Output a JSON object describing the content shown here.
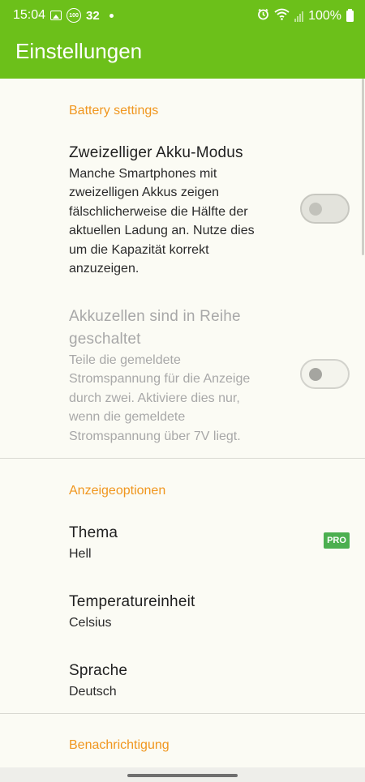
{
  "status_bar": {
    "time": "15:04",
    "badge_icon_text": "100",
    "notification_count": "32",
    "battery": "100%"
  },
  "app_bar": {
    "title": "Einstellungen",
    "background": "#6cc01a"
  },
  "sections": {
    "battery": {
      "header": "Battery settings",
      "dual_cell": {
        "title": "Zweizelliger Akku-Modus",
        "summary": "Manche Smartphones mit zweizelligen Akkus zeigen fälschlicherweise die Hälfte der aktuellen Ladung an. Nutze dies um die Kapazität korrekt anzuzeigen.",
        "checked": false,
        "enabled": true
      },
      "series_cells": {
        "title": "Akkuzellen sind in Reihe geschaltet",
        "summary": "Teile die gemeldete Stromspannung für die Anzeige durch zwei. Aktiviere dies nur, wenn die gemeldete Stromspannung über 7V liegt.",
        "checked": false,
        "enabled": false
      }
    },
    "display": {
      "header": "Anzeigeoptionen",
      "theme": {
        "title": "Thema",
        "value": "Hell",
        "badge": "PRO"
      },
      "temperature": {
        "title": "Temperatureinheit",
        "value": "Celsius"
      },
      "language": {
        "title": "Sprache",
        "value": "Deutsch"
      }
    },
    "notification": {
      "header": "Benachrichtigung"
    }
  },
  "colors": {
    "accent": "#f0961e",
    "pro_badge": "#4caf50"
  }
}
